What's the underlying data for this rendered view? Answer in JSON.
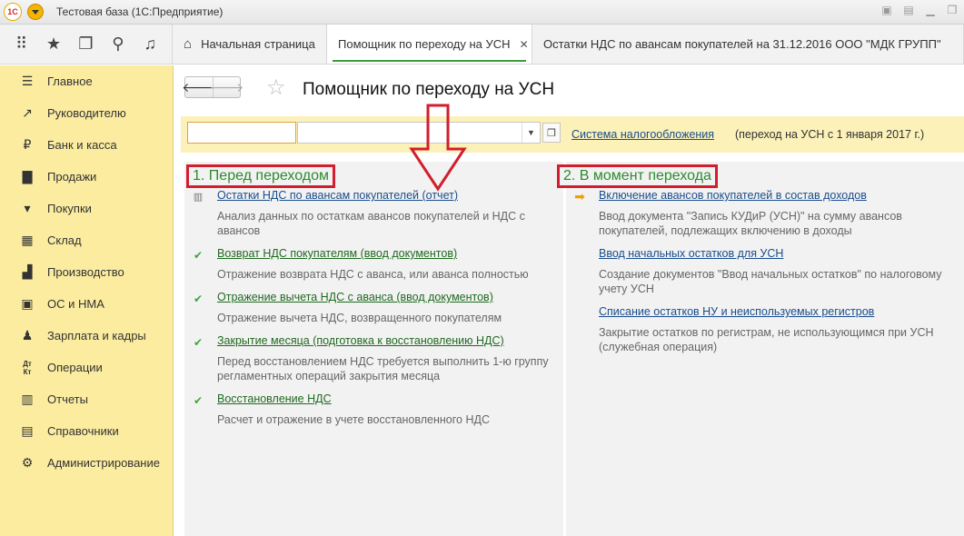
{
  "window": {
    "logo": "1С",
    "title": "Тестовая база  (1С:Предприятие)"
  },
  "tabs": [
    {
      "label": "Начальная страница",
      "active": false
    },
    {
      "label": "Помощник по переходу на УСН",
      "active": true
    },
    {
      "label": "Остатки НДС по авансам покупателей на 31.12.2016 ООО \"МДК ГРУПП\"",
      "active": false
    }
  ],
  "sidebar": {
    "items": [
      {
        "label": "Главное",
        "icon": "menu-lines-icon"
      },
      {
        "label": "Руководителю",
        "icon": "trend-up-icon"
      },
      {
        "label": "Банк и касса",
        "icon": "ruble-icon"
      },
      {
        "label": "Продажи",
        "icon": "shopping-bag-icon"
      },
      {
        "label": "Покупки",
        "icon": "cart-icon"
      },
      {
        "label": "Склад",
        "icon": "warehouse-grid-icon"
      },
      {
        "label": "Производство",
        "icon": "factory-icon"
      },
      {
        "label": "ОС и НМА",
        "icon": "assets-icon"
      },
      {
        "label": "Зарплата и кадры",
        "icon": "person-icon"
      },
      {
        "label": "Операции",
        "icon": "dt-kt-icon"
      },
      {
        "label": "Отчеты",
        "icon": "report-icon"
      },
      {
        "label": "Справочники",
        "icon": "book-icon"
      },
      {
        "label": "Администрирование",
        "icon": "gear-icon"
      }
    ]
  },
  "page": {
    "title": "Помощник по переходу на УСН"
  },
  "filter": {
    "left_value": "",
    "combo_value": "",
    "system_link": "Система налогообложения",
    "system_note": "(переход на УСН с 1 января 2017 г.)"
  },
  "left_section": {
    "title": "1. Перед переходом",
    "entries": [
      {
        "icon": "report-icon",
        "link": "Остатки НДС по авансам покупателей (отчет)",
        "link_color": "blue",
        "desc": "Анализ данных по остаткам авансов покупателей и НДС с авансов"
      },
      {
        "icon": "check-icon",
        "link": "Возврат НДС покупателям (ввод документов)",
        "link_color": "green",
        "desc": "Отражение возврата НДС с аванса, или аванса полностью"
      },
      {
        "icon": "check-icon",
        "link": "Отражение вычета НДС с аванса (ввод документов)",
        "link_color": "green",
        "desc": "Отражение вычета НДС, возвращенного покупателям"
      },
      {
        "icon": "check-icon",
        "link": "Закрытие месяца (подготовка к восстановлению НДС)",
        "link_color": "green",
        "desc": "Перед восстановлением НДС требуется выполнить 1-ю группу регламентных операций закрытия месяца"
      },
      {
        "icon": "check-icon",
        "link": "Восстановление НДС",
        "link_color": "green",
        "desc": "Расчет и отражение в учете восстановленного НДС"
      }
    ]
  },
  "right_section": {
    "title": "2. В момент перехода",
    "entries": [
      {
        "icon": "arrow-right-icon",
        "link": "Включение авансов покупателей в состав доходов",
        "desc": "Ввод документа \"Запись КУДиР (УСН)\" на сумму авансов покупателей, подлежащих включению в доходы"
      },
      {
        "icon": "",
        "link": "Ввод начальных остатков для УСН",
        "desc": "Создание документов \"Ввод начальных остатков\" по налоговому учету УСН"
      },
      {
        "icon": "",
        "link": "Списание остатков НУ и неиспользуемых регистров",
        "desc": "Закрытие остатков по  регистрам, не использующимся при УСН (служебная операция)"
      }
    ]
  }
}
